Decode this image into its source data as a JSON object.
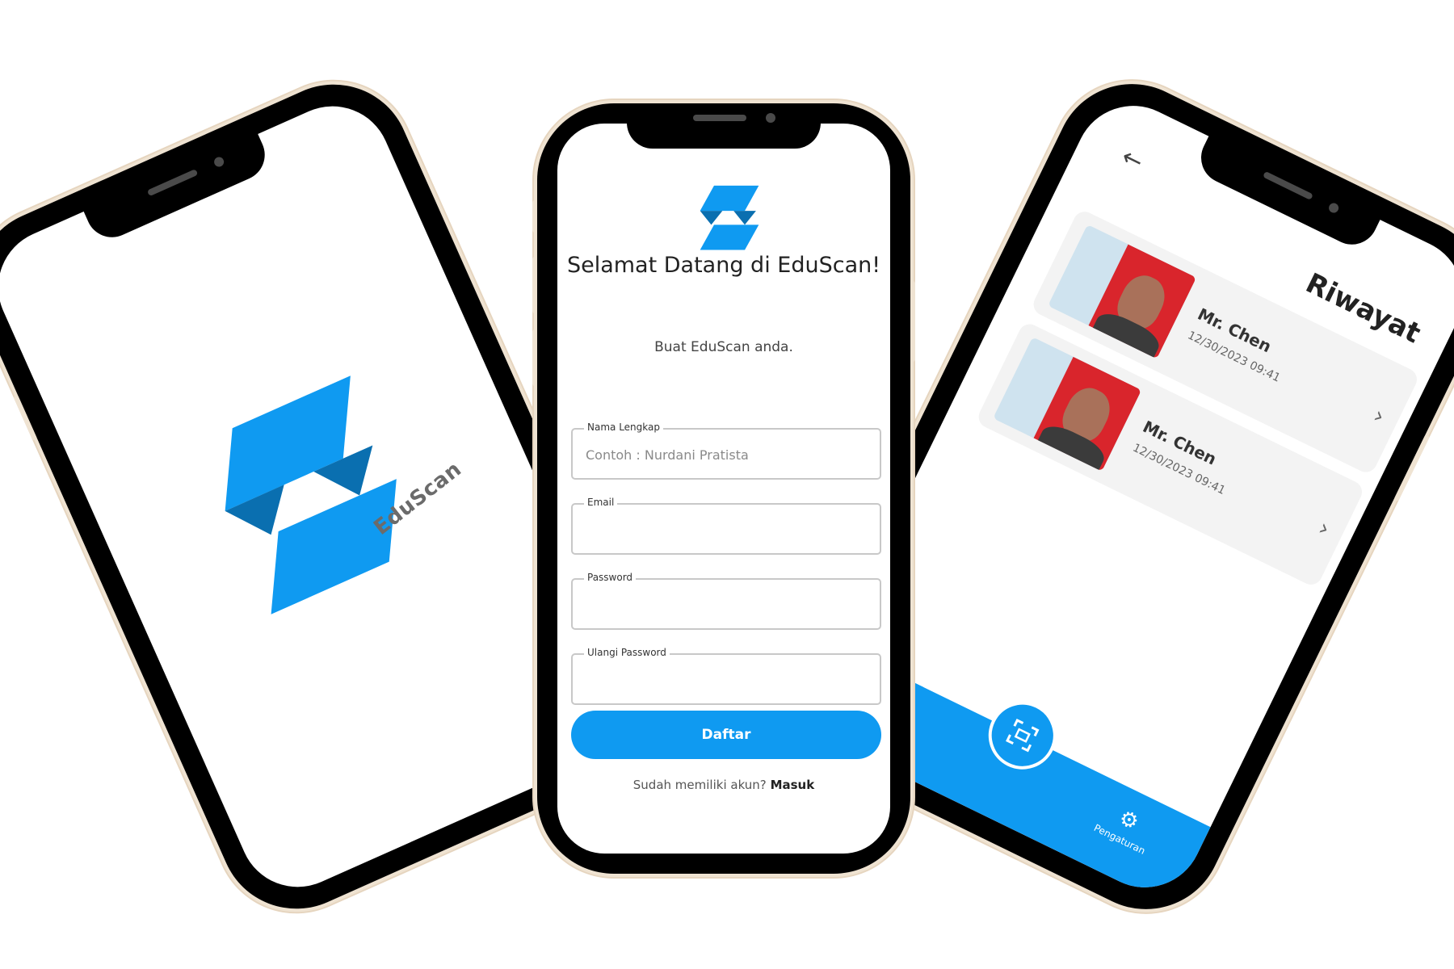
{
  "brand": {
    "primary_color": "#0f9af1",
    "dark_color": "#0a6fb0",
    "bezel_color": "#000000"
  },
  "splash": {
    "app_name": "EduScan"
  },
  "register": {
    "title": "Selamat Datang di EduScan!",
    "subtitle": "Buat EduScan anda.",
    "fields": [
      {
        "label": "Nama Lengkap",
        "placeholder": "Contoh : Nurdani Pratista",
        "value": ""
      },
      {
        "label": "Email",
        "placeholder": "",
        "value": ""
      },
      {
        "label": "Password",
        "placeholder": "",
        "value": ""
      },
      {
        "label": "Ulangi Password",
        "placeholder": "",
        "value": ""
      }
    ],
    "submit_label": "Daftar",
    "login_prompt": "Sudah memiliki akun?",
    "login_link": "Masuk"
  },
  "history": {
    "title": "Riwayat",
    "back_icon": "back-arrow-icon",
    "items": [
      {
        "name": "Mr. Chen",
        "date": "12/30/2023   09:41"
      },
      {
        "name": "Mr. Chen",
        "date": "12/30/2023   09:41"
      }
    ],
    "nav": {
      "scan_icon": "scan-icon",
      "settings_icon": "gear-icon",
      "settings_label": "Pengaturan"
    }
  }
}
